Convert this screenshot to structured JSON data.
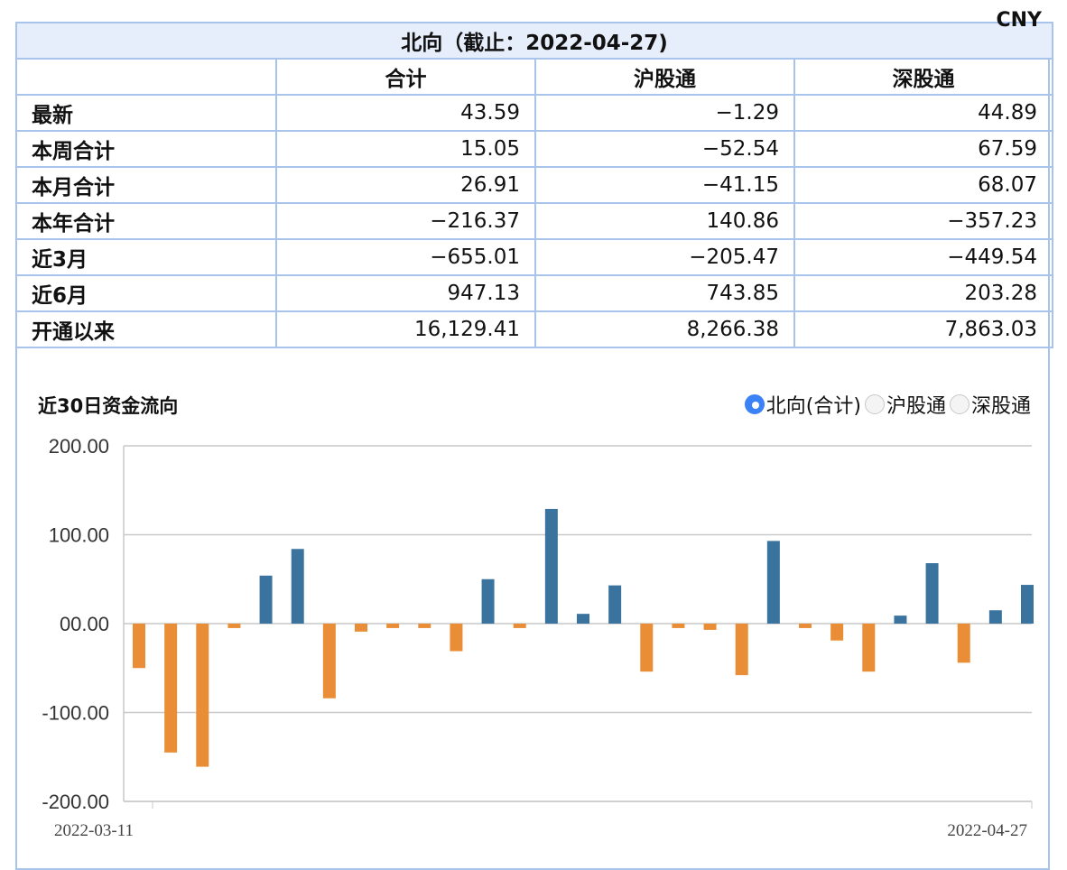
{
  "header": {
    "title": "北向（截止：2022-04-27)",
    "currency": "CNY"
  },
  "columns": [
    "合计",
    "沪股通",
    "深股通"
  ],
  "rows": [
    {
      "label": "最新",
      "values": [
        "43.59",
        "−1.29",
        "44.89"
      ]
    },
    {
      "label": "本周合计",
      "values": [
        "15.05",
        "−52.54",
        "67.59"
      ]
    },
    {
      "label": "本月合计",
      "values": [
        "26.91",
        "−41.15",
        "68.07"
      ]
    },
    {
      "label": "本年合计",
      "values": [
        "−216.37",
        "140.86",
        "−357.23"
      ]
    },
    {
      "label": "近3月",
      "values": [
        "−655.01",
        "−205.47",
        "−449.54"
      ]
    },
    {
      "label": "近6月",
      "values": [
        "947.13",
        "743.85",
        "203.28"
      ]
    },
    {
      "label": "开通以来",
      "values": [
        "16,129.41",
        "8,266.38",
        "7,863.03"
      ]
    }
  ],
  "legend": {
    "options": [
      "北向(合计)",
      "沪股通",
      "深股通"
    ],
    "selected": "北向(合计)"
  },
  "colors": {
    "positive": "#3a749e",
    "negative": "#e98e36",
    "border": "#a9c4ec",
    "header_bg": "#e6eefb",
    "accent": "#3a82f6"
  },
  "chart_data": {
    "type": "bar",
    "title": "近30日资金流向",
    "x_start_label": "2022-03-11",
    "x_end_label": "2022-04-27",
    "ylim": [
      -200,
      200
    ],
    "yticks": [
      "200.00",
      "100.00",
      "00.00",
      "-100.00",
      "-200.00"
    ],
    "grid": true,
    "values": [
      -50,
      -145,
      -161,
      -5,
      54,
      84,
      -84,
      -9,
      -5,
      -5,
      -31,
      50,
      -5,
      129,
      11,
      43,
      -54,
      -5,
      -7,
      -58,
      93,
      -5,
      -19,
      -54,
      9,
      68,
      -44,
      15,
      43.59
    ]
  }
}
